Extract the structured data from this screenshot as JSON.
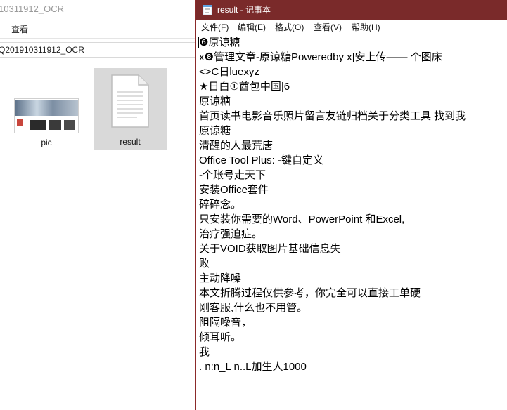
{
  "explorer": {
    "title_fragment": "10311912_OCR",
    "ribbon_tab": "查看",
    "address_fragment": "Q201910311912_OCR",
    "files": [
      {
        "name": "pic",
        "icon": "image-thumbnail-icon"
      },
      {
        "name": "result",
        "icon": "text-document-icon"
      }
    ]
  },
  "notepad": {
    "title": "result - 记事本",
    "menu": {
      "file": "文件(F)",
      "edit": "编辑(E)",
      "format": "格式(O)",
      "view": "查看(V)",
      "help": "帮助(H)"
    },
    "lines": [
      "❻原谅糖",
      "x❽管理文章-原谅糖Poweredby x|安上传—— 个图床",
      "<>C日luexyz",
      "★日白①酋包中国|6",
      "原谅糖",
      "首页读书电影音乐照片留言友链归档关于分类工具 找到我",
      "原谅糖",
      "清醒的人最荒唐",
      "Office Tool Plus: -键自定义",
      "-个账号走天下",
      "安装Office套件",
      "碎碎念。",
      "只安装你需要的Word、PowerPoint 和Excel,",
      "治疗强迫症。",
      "关于VOID获取图片基础信息失",
      "败",
      "主动降噪",
      "本文折腾过程仅供参考，你完全可以直接工单硬",
      "刚客服,什么也不用管。",
      "阻隔噪音，",
      "倾耳听。",
      "我",
      ". n:n_L n..L加生人1000"
    ]
  },
  "colors": {
    "titlebar": "#7a2a2a",
    "selection": "#d9d9d9"
  }
}
